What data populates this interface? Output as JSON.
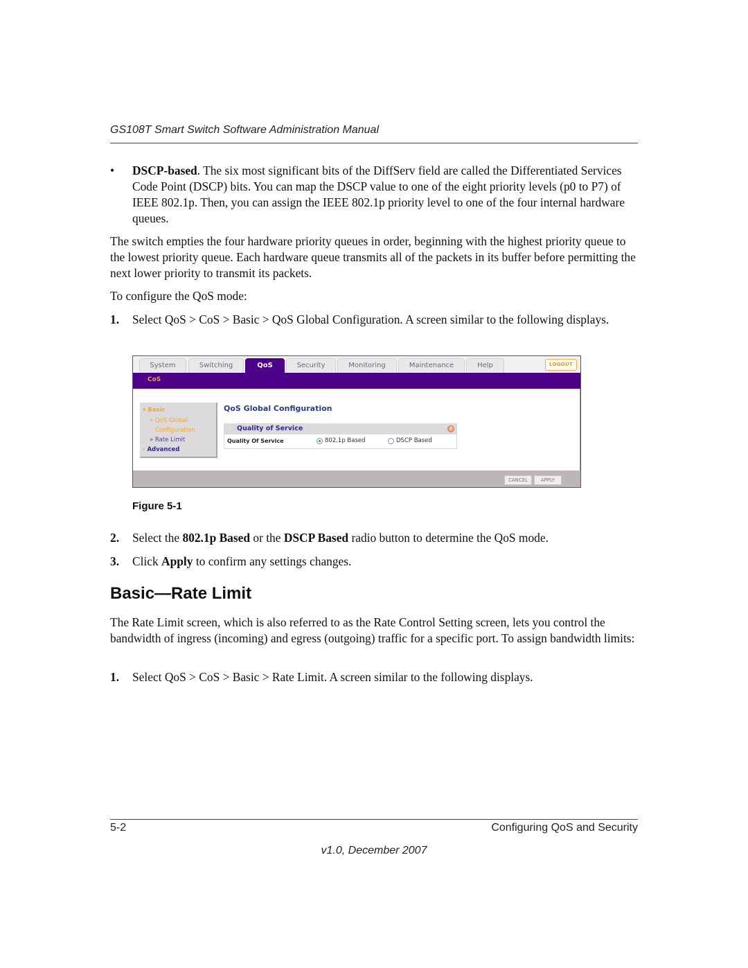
{
  "header": {
    "title": "GS108T Smart Switch Software Administration Manual"
  },
  "bullet": {
    "symbol": "•",
    "term": "DSCP-based",
    "text": ". The six most significant bits of the DiffServ field are called the Differentiated Services Code Point (DSCP) bits. You can map the DSCP value to one of the eight priority levels (p0 to P7) of IEEE 802.1p. Then, you can assign the IEEE 802.1p priority level to one of the four internal hardware queues."
  },
  "paragraphs": {
    "queue_order": "The switch empties the four hardware priority queues in order, beginning with the highest priority queue to the lowest priority queue. Each hardware queue transmits all of the packets in its buffer before permitting the next lower priority to transmit its packets.",
    "configure_intro": "To configure the QoS mode:",
    "rate_limit_intro": "The Rate Limit screen, which is also referred to as the Rate Control Setting screen, lets you control the bandwidth of ingress (incoming) and egress (outgoing) traffic for a specific port. To assign bandwidth limits:"
  },
  "steps_qos_mode": [
    {
      "num": "1.",
      "text": "Select QoS > CoS > Basic > QoS Global Configuration. A screen similar to the following displays."
    },
    {
      "num": "2.",
      "pre": "Select the ",
      "b1": "802.1p Based",
      "mid": " or the ",
      "b2": "DSCP Based",
      "post": " radio button to determine the QoS mode."
    },
    {
      "num": "3.",
      "pre": "Click ",
      "b1": "Apply",
      "post": " to confirm any settings changes."
    }
  ],
  "figure": {
    "caption": "Figure 5-1",
    "ui": {
      "tabs": [
        {
          "label": "System",
          "active": false
        },
        {
          "label": "Switching",
          "active": false
        },
        {
          "label": "QoS",
          "active": true
        },
        {
          "label": "Security",
          "active": false
        },
        {
          "label": "Monitoring",
          "active": false
        },
        {
          "label": "Maintenance",
          "active": false
        },
        {
          "label": "Help",
          "active": false
        }
      ],
      "logout_label": "LOGOUT",
      "subnav_label": "CoS",
      "leftnav": {
        "basic": "Basic",
        "qos_global_1": "» QoS Global",
        "qos_global_2": "Configuration",
        "rate_limit": "» Rate Limit",
        "advanced": "Advanced"
      },
      "page_title": "QoS Global Configuration",
      "panel_title": "Quality of Service",
      "help_icon": "?",
      "field_label": "Quality Of Service",
      "options": [
        {
          "label": "802.1p Based",
          "selected": true
        },
        {
          "label": "DSCP Based",
          "selected": false
        }
      ],
      "cancel_label": "CANCEL",
      "apply_label": "APPLY",
      "colors": {
        "brand_purple": "#4b0087",
        "nav_orange": "#f0a830",
        "title_blue": "#2c3a8c"
      }
    }
  },
  "section": {
    "heading": "Basic—Rate Limit"
  },
  "steps_rate_limit": [
    {
      "num": "1.",
      "text": "Select QoS > CoS > Basic > Rate Limit. A screen similar to the following displays."
    }
  ],
  "footer": {
    "page_number": "5-2",
    "chapter": "Configuring QoS and Security",
    "version": "v1.0, December 2007"
  }
}
